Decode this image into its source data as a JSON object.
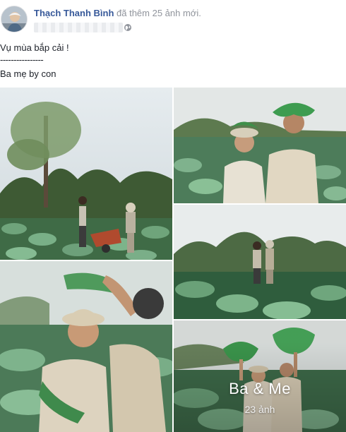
{
  "post": {
    "author_name": "Thạch Thanh Bình",
    "action_text": "đã thêm 25 ảnh mới.",
    "audience_icon": "globe-icon",
    "caption": {
      "line1": "Vụ mùa bắp cải !",
      "line2": "----------------",
      "line3": "Ba mẹ by con"
    }
  },
  "album": {
    "title": "Ba & Me",
    "photo_count": "23 ảnh"
  },
  "colors": {
    "name_link": "#365899",
    "secondary_text": "#90949c",
    "body_text": "#1d2129"
  }
}
